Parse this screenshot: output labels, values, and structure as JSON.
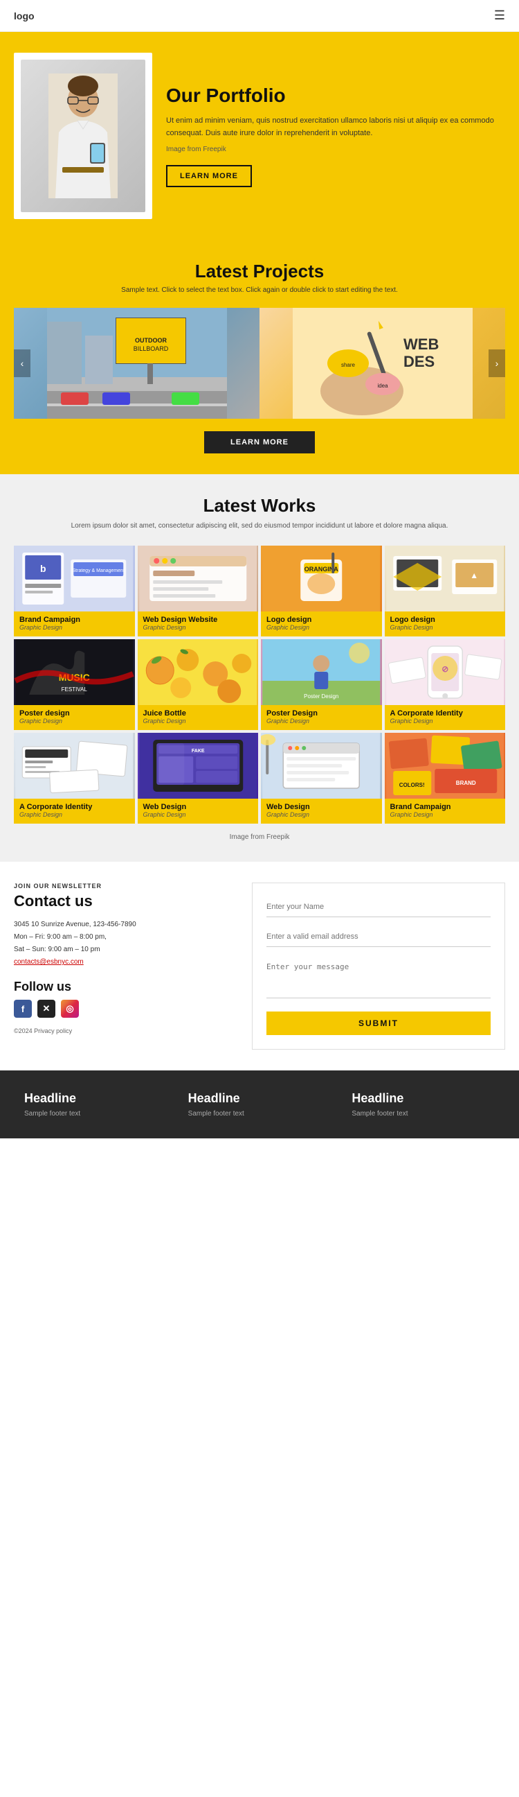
{
  "header": {
    "logo": "logo",
    "hamburger": "☰"
  },
  "hero": {
    "title": "Our Portfolio",
    "description": "Ut enim ad minim veniam, quis nostrud exercitation ullamco laboris nisi ut aliquip ex ea commodo consequat. Duis aute irure dolor in reprehenderit in voluptate.",
    "image_credit": "Image from Freepik",
    "button": "LEARN MORE"
  },
  "latest_projects": {
    "title": "Latest Projects",
    "subtitle": "Sample text. Click to select the text box. Click again or double click to start editing the text.",
    "button": "LEARN MORE",
    "images": [
      {
        "label": "Billboard Project",
        "color": "img-billboard"
      },
      {
        "label": "Web Design",
        "color": "img-webdes"
      }
    ]
  },
  "latest_works": {
    "title": "Latest Works",
    "subtitle": "Lorem ipsum dolor sit amet, consectetur adipiscing elit, sed do eiusmod tempor incididunt ut labore et dolore magna aliqua.",
    "freepik": "Image from Freepik",
    "items": [
      {
        "title": "Brand Campaign",
        "category": "Graphic Design",
        "img": "img-brand1"
      },
      {
        "title": "Web Design Website",
        "category": "Graphic Design",
        "img": "img-webdessite"
      },
      {
        "title": "Logo design",
        "category": "Graphic Design",
        "img": "img-orange"
      },
      {
        "title": "Logo design",
        "category": "Graphic Design",
        "img": "img-logodes"
      },
      {
        "title": "Poster design",
        "category": "Graphic Design",
        "img": "img-poster"
      },
      {
        "title": "Juice Bottle",
        "category": "Graphic Design",
        "img": "img-juice"
      },
      {
        "title": "Poster Design",
        "category": "Graphic Design",
        "img": "img-posterdes"
      },
      {
        "title": "A Corporate Identity",
        "category": "Graphic Design",
        "img": "img-corpid"
      },
      {
        "title": "A Corporate Identity",
        "category": "Graphic Design",
        "img": "img-corpid2"
      },
      {
        "title": "Web Design",
        "category": "Graphic Design",
        "img": "img-fakeweb"
      },
      {
        "title": "Web Design",
        "category": "Graphic Design",
        "img": "img-webdes2"
      },
      {
        "title": "Brand Campaign",
        "category": "Graphic Design",
        "img": "img-brandcamp"
      }
    ]
  },
  "contact": {
    "newsletter_label": "JOIN OUR NEWSLETTER",
    "title": "Contact us",
    "address": "3045 10 Sunrize Avenue, 123-456-7890",
    "hours1": "Mon – Fri: 9:00 am – 8:00 pm,",
    "hours2": "Sat – Sun: 9:00 am – 10 pm",
    "email": "contacts@esbnyc.com",
    "follow_title": "Follow us",
    "copyright": "©2024 Privacy policy",
    "form": {
      "name_placeholder": "Enter your Name",
      "email_placeholder": "Enter a valid email address",
      "message_placeholder": "Enter your message",
      "submit": "SUBMIT"
    }
  },
  "footer": {
    "columns": [
      {
        "headline": "Headline",
        "sub": "Sample footer text"
      },
      {
        "headline": "Headline",
        "sub": "Sample footer text"
      },
      {
        "headline": "Headline",
        "sub": "Sample footer text"
      }
    ]
  }
}
